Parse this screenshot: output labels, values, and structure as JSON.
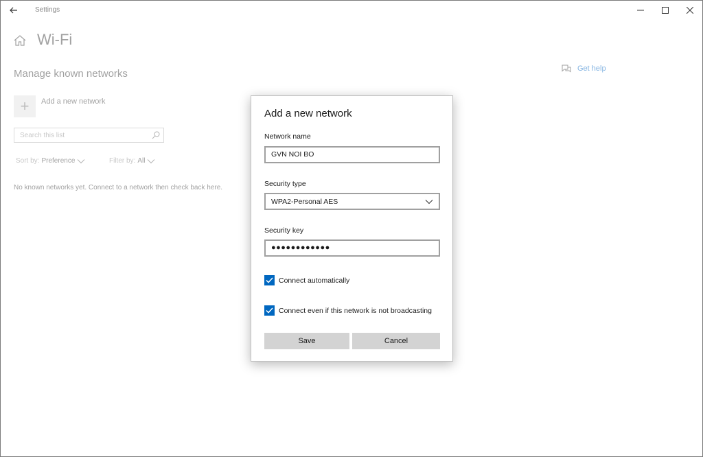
{
  "window": {
    "app_title": "Settings",
    "controls": {
      "minimize": "minimize-icon",
      "maximize": "maximize-icon",
      "close": "close-icon"
    }
  },
  "page": {
    "title": "Wi-Fi",
    "section_title": "Manage known networks",
    "get_help": "Get help",
    "add_network": "Add a new network",
    "search": {
      "placeholder": "Search this list"
    },
    "sort": {
      "label": "Sort by:",
      "value": "Preference"
    },
    "filter": {
      "label": "Filter by:",
      "value": "All"
    },
    "empty_message": "No known networks yet. Connect to a network then check back here."
  },
  "dialog": {
    "title": "Add a new network",
    "network_name": {
      "label": "Network name",
      "value": "GVN NOI BO"
    },
    "security_type": {
      "label": "Security type",
      "value": "WPA2-Personal AES"
    },
    "security_key": {
      "label": "Security key",
      "value": "●●●●●●●●●●●●"
    },
    "connect_auto": {
      "label": "Connect automatically",
      "checked": true
    },
    "connect_hidden": {
      "label": "Connect even if this network is not broadcasting",
      "checked": true
    },
    "save_label": "Save",
    "cancel_label": "Cancel"
  },
  "colors": {
    "accent": "#0067c0",
    "link": "#1a73c8",
    "button_bg": "#d3d3d3"
  }
}
